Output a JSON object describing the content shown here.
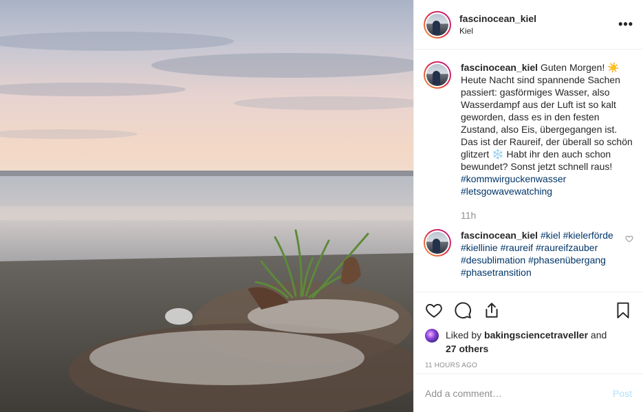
{
  "post": {
    "username": "fascinocean_kiel",
    "location": "Kiel",
    "more_label": "•••"
  },
  "caption": {
    "username": "fascinocean_kiel",
    "text_1": "Guten Morgen! ☀️ Heute Nacht sind spannende Sachen passiert: gasförmiges Wasser, also Wasserdampf aus der Luft ist so kalt geworden, dass es in den festen Zustand, also Eis, übergegangen ist. Das ist der Raureif, der überall so schön glitzert ❄️ Habt ihr den auch schon bewundet? Sonst jetzt schnell raus!",
    "hashtags": [
      "#kommwirguckenwasser",
      "#letsgowavewatching"
    ],
    "time": "11h"
  },
  "comment": {
    "username": "fascinocean_kiel",
    "hashtags": [
      "#kiel",
      "#kielerförde",
      "#kiellinie",
      "#raureif",
      "#raureifzauber",
      "#desublimation",
      "#phasenübergang",
      "#phasetransition"
    ]
  },
  "likes": {
    "prefix": "Liked by",
    "user": "bakingsciencetraveller",
    "suffix": "and",
    "others": "27 others"
  },
  "timestamp": "11 hours ago",
  "comment_input": {
    "placeholder": "Add a comment…",
    "post_label": "Post"
  },
  "icons": {
    "like": "heart-icon",
    "comment": "comment-bubble-icon",
    "share": "share-icon",
    "save": "bookmark-icon",
    "comment_like": "heart-icon"
  },
  "colors": {
    "hashtag": "#003569",
    "muted": "#8e8e8e",
    "post_disabled": "#b2dffc"
  }
}
